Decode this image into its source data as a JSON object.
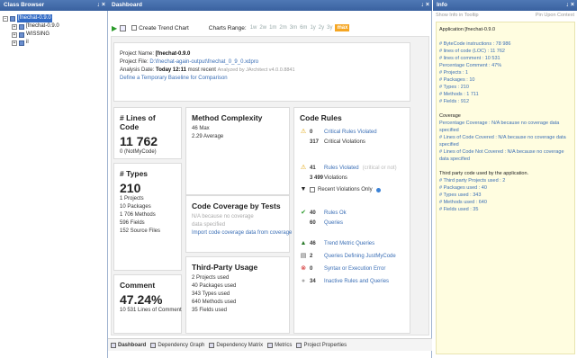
{
  "class_browser": {
    "title": "Class Browser",
    "controls": "↓ ×",
    "tree": [
      {
        "label": "[fnechat-0.9.0",
        "selected": true
      },
      {
        "label": "[fnechat-0.9.0"
      },
      {
        "label": "WISSING"
      },
      {
        "label": "il"
      }
    ]
  },
  "dashboard": {
    "title": "Dashboard",
    "controls": "↓ ×",
    "toolbar": {
      "create_trend": "Create Trend Chart",
      "charts_range_label": "Charts Range:",
      "range_options": [
        "1w",
        "2w",
        "1m",
        "2m",
        "3m",
        "6m",
        "1y",
        "2y",
        "3y"
      ],
      "range_active": "max"
    },
    "project": {
      "name_label": "Project Name:",
      "name_value": "[fnechat-0.9.0",
      "file_label": "Project File:",
      "file_value": "D:\\fnechat-again-output\\fnechat_0_9_0.xdpro",
      "date_label": "Analysis Date:",
      "date_value": "Today 12:11",
      "date_suffix": "most recent",
      "date_note": "Analyzed by JArchitect v4.0.0.8841",
      "baseline_link": "Define a Temporary Baseline for Comparison"
    },
    "loc": {
      "title": "# Lines of Code",
      "value": "11 762",
      "sub": "0 (NotMyCode)"
    },
    "types": {
      "title": "# Types",
      "value": "210",
      "items": [
        "1  Projects",
        "10  Packages",
        "1 706  Methods",
        "596  Fields",
        "152  Source Files"
      ]
    },
    "comment": {
      "title": "Comment",
      "value": "47.24%",
      "sub": "10 531  Lines of Comment"
    },
    "complexity": {
      "title": "Method Complexity",
      "items": [
        "46  Max",
        "2.29  Average"
      ]
    },
    "coverage": {
      "title": "Code Coverage by Tests",
      "muted": [
        "N/A because no coverage",
        "data specified"
      ],
      "link": "Import code coverage data from coverage file(s)"
    },
    "third_party": {
      "title": "Third-Party Usage",
      "items": [
        "2  Projects used",
        "40  Packages used",
        "343  Types used",
        "640  Methods used",
        "35  Fields used"
      ]
    },
    "rules": {
      "title": "Code Rules",
      "critical_num": "0",
      "critical_label": "Critical Rules Violated",
      "critical_viol_num": "317",
      "critical_viol_label": "Critical Violations",
      "violated_num": "41",
      "violated_label": "Rules Violated",
      "violated_hint": "(critical or not)",
      "violations_num": "3 499",
      "violations_label": "Violations",
      "recent_only": "Recent Violations Only",
      "ok_num": "40",
      "ok_label": "Rules Ok",
      "queries_num": "60",
      "queries_label": "Queries",
      "trend_num": "46",
      "trend_label": "Trend Metric Queries",
      "justmycode_num": "2",
      "justmycode_label": "Queries Defining JustMyCode",
      "error_num": "0",
      "error_label": "Syntax or Execution Error",
      "inactive_num": "34",
      "inactive_label": "Inactive Rules and Queries"
    },
    "bottom_tabs": [
      "Dashboard",
      "Dependency Graph",
      "Dependency Matrix",
      "Metrics",
      "Project Properties"
    ]
  },
  "info": {
    "title": "Info",
    "controls": "↓ ×",
    "toolbar_left": "Show Info in Tooltip",
    "toolbar_right": "Pin Upon Context",
    "lines": [
      {
        "t": "Application [fnechat-0.9.0",
        "dark": true
      },
      {
        "t": ""
      },
      {
        "t": "# ByteCode instructions  :  78 986"
      },
      {
        "t": "# lines of code (LOC)  :  11 762"
      },
      {
        "t": "# lines of comment  :  10 531"
      },
      {
        "t": "Percentage Comment  :  47%"
      },
      {
        "t": "# Projects  :  1"
      },
      {
        "t": "# Packages  :  10"
      },
      {
        "t": "# Types  :  210"
      },
      {
        "t": "# Methods  :  1 711"
      },
      {
        "t": "# Fields  :  912"
      },
      {
        "t": ""
      },
      {
        "t": "Coverage",
        "dark": true
      },
      {
        "t": "Percentage Coverage  :  N/A because no coverage data specified",
        "wrap": true
      },
      {
        "t": "# Lines of Code Covered  :  N/A because no coverage data specified",
        "wrap": true
      },
      {
        "t": "# Lines of Code Not Covered  :  N/A because no coverage data specified",
        "wrap": true
      },
      {
        "t": ""
      },
      {
        "t": "Third party code used by the application.",
        "dark": true
      },
      {
        "t": "# Third party Projects used  :  2"
      },
      {
        "t": "# Packages used  :  40"
      },
      {
        "t": "# Types used  :  343"
      },
      {
        "t": "# Methods used  :  640"
      },
      {
        "t": "# Fields used  :  35"
      }
    ]
  },
  "colors": {
    "title_bar": "#3a62a0",
    "link": "#3b6fb6",
    "active_range": "#f5a623",
    "info_bg": "#fffde0"
  }
}
